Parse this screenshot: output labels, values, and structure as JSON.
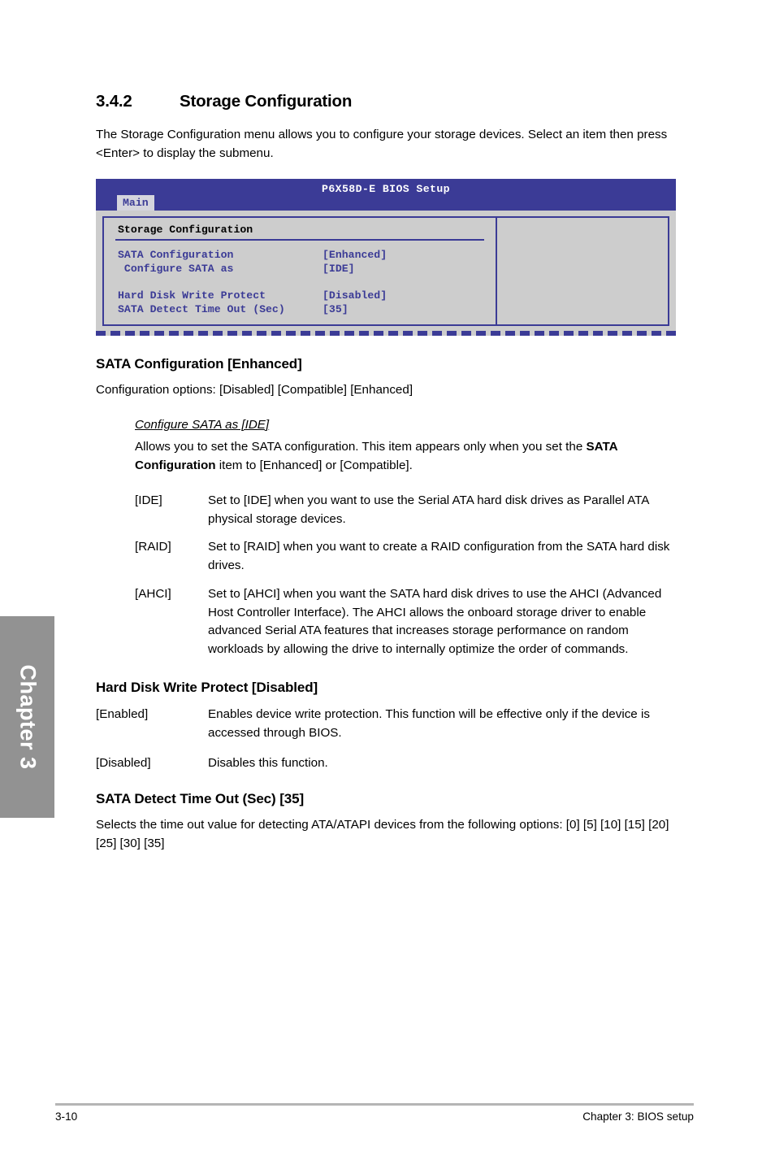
{
  "chapter_tab": {
    "label": "Chapter 3"
  },
  "section": {
    "number": "3.4.2",
    "title": "Storage Configuration",
    "intro": "The Storage Configuration menu allows you to configure your storage devices. Select an item then press <Enter> to display the submenu."
  },
  "bios_screen": {
    "title": "P6X58D-E BIOS Setup",
    "active_tab": "Main",
    "panel_title": "Storage Configuration",
    "rows": [
      {
        "label": "SATA Configuration",
        "value": "[Enhanced]"
      },
      {
        "label": " Configure SATA as",
        "value": "[IDE]"
      },
      {
        "label": "Hard Disk Write Protect",
        "value": "[Disabled]"
      },
      {
        "label": "SATA Detect Time Out (Sec)",
        "value": "[35]"
      }
    ],
    "help_panel_text": ""
  },
  "items": [
    {
      "heading": "SATA Configuration [Enhanced]",
      "body": "Configuration options: [Disabled] [Compatible] [Enhanced]",
      "sub": {
        "heading": "Configure SATA as [IDE]",
        "body_pre": "Allows you to set the SATA configuration. This item appears only when you set the ",
        "body_bold": "SATA Configuration",
        "body_post": " item to [Enhanced] or [Compatible]."
      },
      "definitions": [
        {
          "term": "[IDE]",
          "desc": "Set to [IDE] when you want to use the Serial ATA hard disk drives as Parallel ATA physical storage devices."
        },
        {
          "term": "[RAID]",
          "desc": "Set to [RAID] when you want to create a RAID configuration from the SATA hard disk drives."
        },
        {
          "term": "[AHCI]",
          "desc": "Set to [AHCI] when you want the SATA hard disk drives to use the AHCI (Advanced Host Controller Interface). The AHCI allows the onboard storage driver to enable advanced Serial ATA features that increases storage performance on random workloads by allowing the drive to internally optimize the order of commands."
        }
      ]
    },
    {
      "heading": "Hard Disk Write Protect [Disabled]",
      "definitions": [
        {
          "term": "[Enabled]",
          "desc": "Enables device write protection. This function will be effective only if the device is accessed through BIOS."
        },
        {
          "term": "[Disabled]",
          "desc": "Disables this function."
        }
      ]
    },
    {
      "heading": "SATA Detect Time Out (Sec) [35]",
      "body": "Selects the time out value for detecting ATA/ATAPI devices from the following options: [0] [5] [10] [15] [20] [25] [30] [35]"
    }
  ],
  "footer": {
    "page_number": "3-10",
    "chapter_label": "Chapter 3: BIOS setup"
  }
}
